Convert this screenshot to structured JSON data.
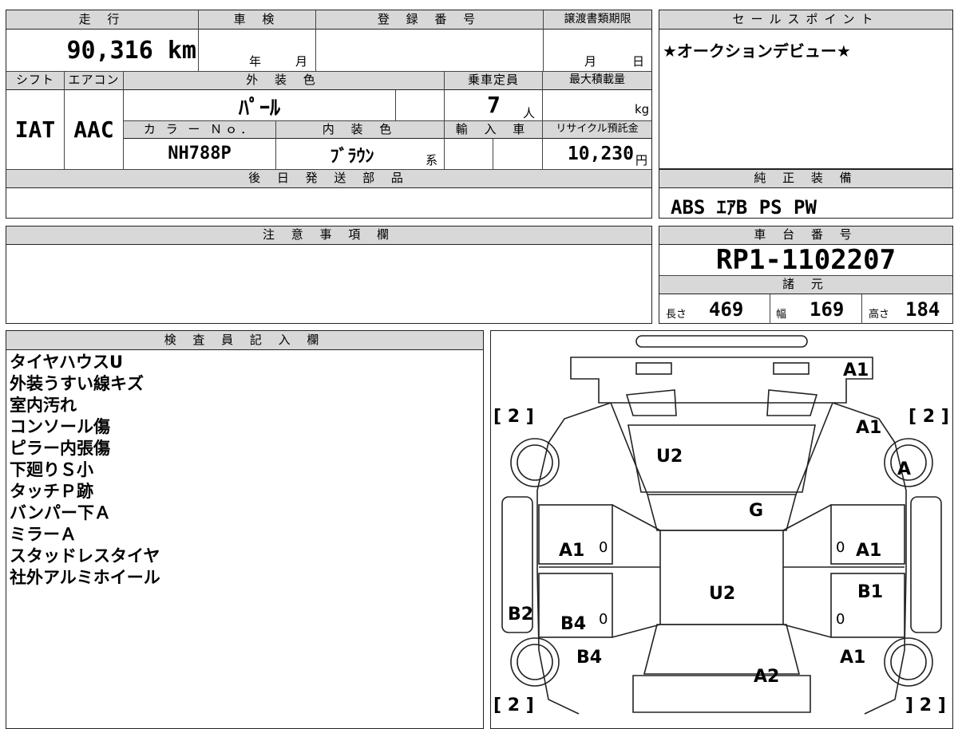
{
  "summary": {
    "mileage_label": "走 行",
    "shaken_label": "車 検",
    "registration_label": "登 録 番 号",
    "transfer_deadline_label": "譲渡書類期限",
    "mileage_value": "90,316 km",
    "shaken_year": "年",
    "shaken_month": "月",
    "deadline_month": "月",
    "deadline_day": "日",
    "shift_label": "シフト",
    "aircon_label": "エアコン",
    "exterior_color_label": "外 装 色",
    "capacity_label": "乗車定員",
    "max_load_label": "最大積載量",
    "shift_value": "IAT",
    "aircon_value": "AAC",
    "exterior_color_value": "ﾊﾟｰﾙ",
    "capacity_value": "7",
    "capacity_unit": "人",
    "load_unit": "kg",
    "color_no_label": "カ ラ ー Ｎｏ．",
    "interior_color_label": "内 装 色",
    "import_label": "輸 入 車",
    "recycle_label": "リサイクル預託金",
    "color_no_value": "NH788P",
    "interior_color_value": "ﾌﾞﾗｳﾝ",
    "interior_suffix": "系",
    "recycle_value": "10,230",
    "recycle_unit": "円",
    "later_parts_label": "後 日 発 送 部 品"
  },
  "sales_point": {
    "label": "セールスポイント",
    "text": "★オークションデビュー★"
  },
  "equipment": {
    "label": "純 正 装 備",
    "text": "ABS ｴｱB PS PW"
  },
  "notes": {
    "label": "注 意 事 項 欄"
  },
  "chassis": {
    "label": "車 台 番 号",
    "value": "RP1-1102207",
    "specs_label": "諸 元",
    "length_label": "長さ",
    "length_value": "469",
    "width_label": "幅",
    "width_value": "169",
    "height_label": "高さ",
    "height_value": "184"
  },
  "inspector": {
    "label": "検 査 員 記 入 欄",
    "lines": [
      "タイヤハウスU",
      "外装うすい線キズ",
      "室内汚れ",
      "コンソール傷",
      "ピラー内張傷",
      "下廻りＳ小",
      "タッチＰ跡",
      "バンパー下Ａ",
      "ミラーＡ",
      "スタッドレスタイヤ",
      "社外アルミホイール"
    ]
  },
  "diagram": {
    "front_bumper": "A1",
    "front_left_fender": "A1",
    "front_right_wheel": "A",
    "hood": "U2",
    "windshield": "G",
    "left_front_door": "A1",
    "right_front_door": "A1",
    "roof": "U2",
    "right_rear_door": "B1",
    "left_rocker": "B2",
    "left_rear_door": "B4",
    "left_rear_fender": "B4",
    "right_rear_fender": "A1",
    "rear": "A2",
    "tread_fl": "2",
    "tread_fr": "2",
    "tread_rl": "2",
    "tread_rr": "2",
    "zero": "0"
  }
}
